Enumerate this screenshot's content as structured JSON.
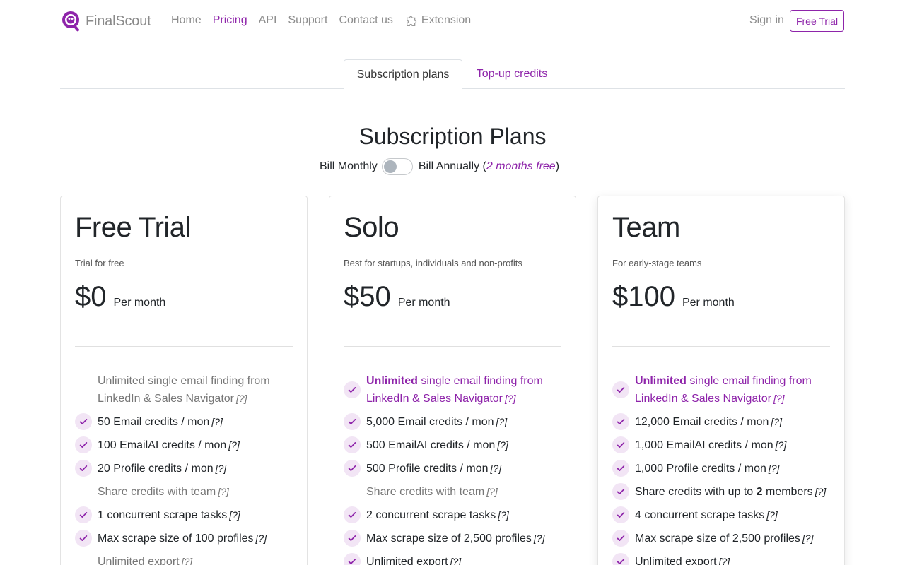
{
  "nav": {
    "brand": "FinalScout",
    "links": [
      "Home",
      "Pricing",
      "API",
      "Support",
      "Contact us"
    ],
    "extension": "Extension",
    "sign_in": "Sign in",
    "free_trial": "Free Trial"
  },
  "tabs": [
    "Subscription plans",
    "Top-up credits"
  ],
  "heading": "Subscription Plans",
  "billing": {
    "monthly": "Bill Monthly",
    "annually": "Bill Annually (",
    "free_note": "2 months free",
    "close_paren": ")",
    "annual_selected": false
  },
  "colors": {
    "accent": "#8e24aa",
    "check_bg": "#f2e5f5"
  },
  "plans": [
    {
      "name": "Free Trial",
      "tagline": "Trial for free",
      "price": "$0",
      "period": "Per month",
      "features": [
        {
          "text": "Unlimited single email finding from LinkedIn & Sales Navigator",
          "hint": "[?]",
          "status": "muted"
        },
        {
          "text": "50 Email credits / mon",
          "hint": "[?]",
          "status": "check"
        },
        {
          "text": "100 EmailAI credits / mon",
          "hint": "[?]",
          "status": "check"
        },
        {
          "text": "20 Profile credits / mon",
          "hint": "[?]",
          "status": "check"
        },
        {
          "text": "Share credits with team",
          "hint": "[?]",
          "status": "muted"
        },
        {
          "text": "1 concurrent scrape tasks",
          "hint": "[?]",
          "status": "check"
        },
        {
          "text": "Max scrape size of 100 profiles",
          "hint": "[?]",
          "status": "check"
        },
        {
          "text": "Unlimited export",
          "hint": "[?]",
          "status": "muted"
        }
      ]
    },
    {
      "name": "Solo",
      "tagline": "Best for startups, individuals and non-profits",
      "price": "$50",
      "period": "Per month",
      "features": [
        {
          "bold": "Unlimited",
          "text": " single email finding from LinkedIn & Sales Navigator",
          "hint": "[?]",
          "status": "accent"
        },
        {
          "text": "5,000 Email credits / mon",
          "hint": "[?]",
          "status": "check"
        },
        {
          "text": "500 EmailAI credits / mon",
          "hint": "[?]",
          "status": "check"
        },
        {
          "text": "500 Profile credits / mon",
          "hint": "[?]",
          "status": "check"
        },
        {
          "text": "Share credits with team",
          "hint": "[?]",
          "status": "muted"
        },
        {
          "text": "2 concurrent scrape tasks",
          "hint": "[?]",
          "status": "check"
        },
        {
          "text": "Max scrape size of 2,500 profiles",
          "hint": "[?]",
          "status": "check"
        },
        {
          "text": "Unlimited export",
          "hint": "[?]",
          "status": "check"
        }
      ]
    },
    {
      "name": "Team",
      "tagline": "For early-stage teams",
      "price": "$100",
      "period": "Per month",
      "features": [
        {
          "bold": "Unlimited",
          "text": " single email finding from LinkedIn & Sales Navigator",
          "hint": "[?]",
          "status": "accent"
        },
        {
          "text": "12,000 Email credits / mon",
          "hint": "[?]",
          "status": "check"
        },
        {
          "text": "1,000 EmailAI credits / mon",
          "hint": "[?]",
          "status": "check"
        },
        {
          "text": "1,000 Profile credits / mon",
          "hint": "[?]",
          "status": "check"
        },
        {
          "text": "Share credits with up to ",
          "bold_mid": "2",
          "text_after": " members",
          "hint": "[?]",
          "status": "check"
        },
        {
          "text": "4 concurrent scrape tasks",
          "hint": "[?]",
          "status": "check"
        },
        {
          "text": "Max scrape size of 2,500 profiles",
          "hint": "[?]",
          "status": "check"
        },
        {
          "text": "Unlimited export",
          "hint": "[?]",
          "status": "check"
        }
      ]
    }
  ]
}
